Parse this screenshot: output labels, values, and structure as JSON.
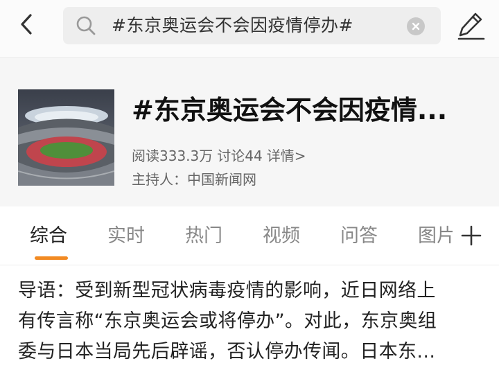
{
  "search": {
    "query": "#东京奥运会不会因疫情停办#"
  },
  "topic": {
    "title": "#东京奥运会不会因疫情...",
    "reads": "阅读333.3万",
    "discussions": "讨论44",
    "details_link": "详情>",
    "host": "主持人：中国新闻网"
  },
  "tabs": [
    {
      "label": "综合"
    },
    {
      "label": "实时"
    },
    {
      "label": "热门"
    },
    {
      "label": "视频"
    },
    {
      "label": "问答"
    },
    {
      "label": "图片"
    }
  ],
  "intro": {
    "line1": "导语：受到新型冠状病毒疫情的影响，近日网络上",
    "line2": "有传言称“东京奥运会或将停办”。对此，东京奥组",
    "line3": "委与日本当局先后辟谣，否认停办传闻。日本东..."
  },
  "colors": {
    "accent": "#f28a22",
    "header_bg": "#f6f6f6",
    "search_bg": "#eeeeee"
  },
  "icons": [
    "back-icon",
    "search-icon",
    "clear-icon",
    "edit-icon",
    "plus-icon"
  ]
}
